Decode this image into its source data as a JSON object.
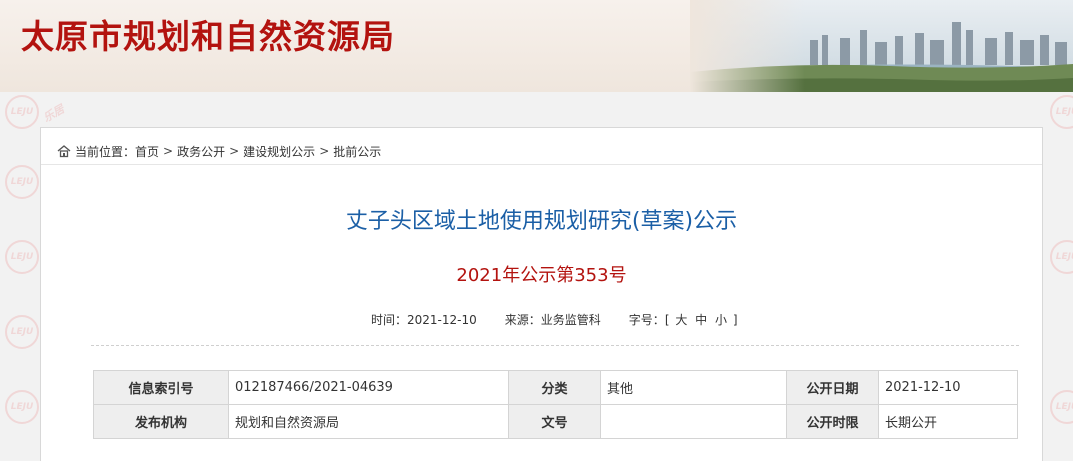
{
  "header": {
    "site_title": "太原市规划和自然资源局"
  },
  "breadcrumb": {
    "prefix": "当前位置：",
    "items": [
      "首页",
      "政务公开",
      "建设规划公示",
      "批前公示"
    ],
    "separator": ">"
  },
  "article": {
    "title": "丈子头区域土地使用规划研究(草案)公示",
    "doc_number": "2021年公示第353号",
    "time_label": "时间：",
    "time_value": "2021-12-10",
    "source_label": "来源：",
    "source_value": "业务监管科",
    "fontsize_label": "字号：",
    "fontsize_open": "[",
    "fontsize_large": "大",
    "fontsize_medium": "中",
    "fontsize_small": "小",
    "fontsize_close": "]"
  },
  "info_table": {
    "row1": {
      "index_label": "信息索引号",
      "index_value": "012187466/2021-04639",
      "category_label": "分类",
      "category_value": "其他",
      "date_label": "公开日期",
      "date_value": "2021-12-10"
    },
    "row2": {
      "publisher_label": "发布机构",
      "publisher_value": "规划和自然资源局",
      "docno_label": "文号",
      "docno_value": "",
      "period_label": "公开时限",
      "period_value": "长期公开"
    }
  },
  "watermark": {
    "logo_text": "LEJU",
    "brand_text": "乐居"
  },
  "colors": {
    "title_red": "#b3130f",
    "link_blue": "#1b5fa6"
  }
}
